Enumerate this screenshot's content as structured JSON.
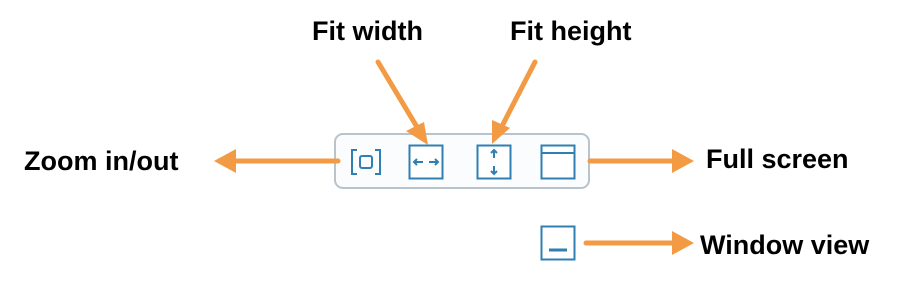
{
  "labels": {
    "fit_width": "Fit width",
    "fit_height": "Fit height",
    "zoom": "Zoom in/out",
    "full_screen": "Full screen",
    "window_view": "Window view"
  },
  "colors": {
    "arrow": "#f39a45",
    "icon": "#2f7fb2",
    "toolbar_border": "#b9c3cc"
  },
  "icons": {
    "zoom": "zoom-frame-icon",
    "fit_width": "horizontal-arrows-icon",
    "fit_height": "vertical-arrows-icon",
    "full_screen": "full-screen-window-icon",
    "window_view": "window-minimize-icon"
  }
}
